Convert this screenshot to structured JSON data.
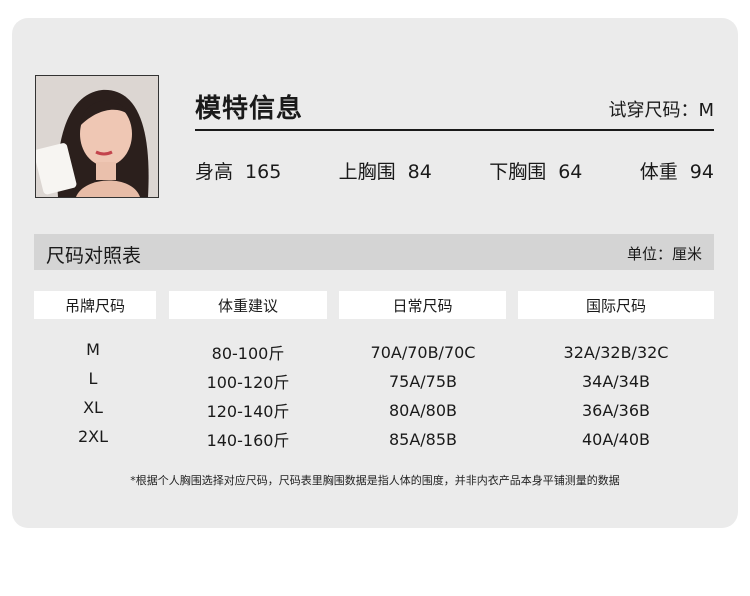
{
  "model": {
    "title": "模特信息",
    "try_size_label": "试穿尺码：",
    "try_size_value": "M",
    "stats": [
      {
        "label": "身高",
        "value": "165"
      },
      {
        "label": "上胸围",
        "value": "84"
      },
      {
        "label": "下胸围",
        "value": "64"
      },
      {
        "label": "体重",
        "value": "94"
      }
    ]
  },
  "size_table": {
    "title": "尺码对照表",
    "unit": "单位：厘米",
    "headers": [
      "吊牌尺码",
      "体重建议",
      "日常尺码",
      "国际尺码"
    ],
    "rows": [
      [
        "M",
        "80-100斤",
        "70A/70B/70C",
        "32A/32B/32C"
      ],
      [
        "L",
        "100-120斤",
        "75A/75B",
        "34A/34B"
      ],
      [
        "XL",
        "120-140斤",
        "80A/80B",
        "36A/36B"
      ],
      [
        "2XL",
        "140-160斤",
        "85A/85B",
        "40A/40B"
      ]
    ],
    "note": "*根据个人胸围选择对应尺码，尺码表里胸围数据是指人体的围度，并非内衣产品本身平铺测量的数据"
  }
}
